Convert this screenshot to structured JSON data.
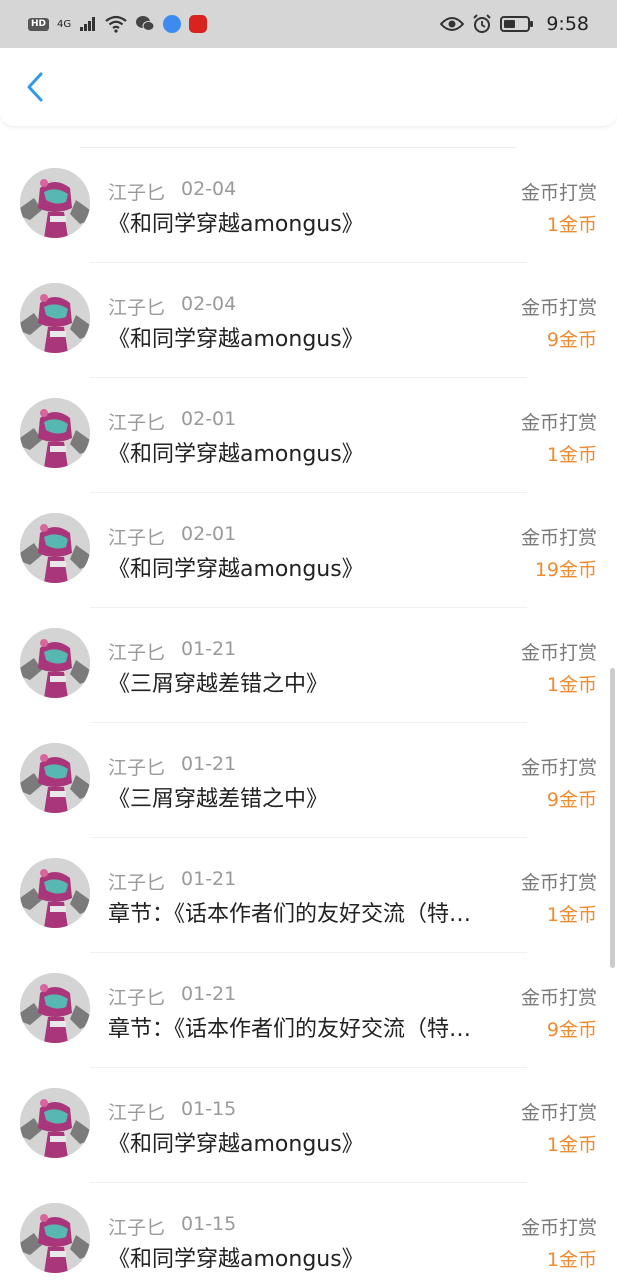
{
  "status_bar": {
    "network": "4G",
    "time": "9:58"
  },
  "nav": {
    "back_icon": "chevron-left-icon",
    "accent": "#2f9be8"
  },
  "colors": {
    "amount": "#f08b2f"
  },
  "records": [
    {
      "user": "江子匕",
      "date": "02-04",
      "title": "《和同学穿越amongus》",
      "type": "金币打赏",
      "amount": "1金币"
    },
    {
      "user": "江子匕",
      "date": "02-04",
      "title": "《和同学穿越amongus》",
      "type": "金币打赏",
      "amount": "9金币"
    },
    {
      "user": "江子匕",
      "date": "02-01",
      "title": "《和同学穿越amongus》",
      "type": "金币打赏",
      "amount": "1金币"
    },
    {
      "user": "江子匕",
      "date": "02-01",
      "title": "《和同学穿越amongus》",
      "type": "金币打赏",
      "amount": "19金币"
    },
    {
      "user": "江子匕",
      "date": "01-21",
      "title": "《三屑穿越差错之中》",
      "type": "金币打赏",
      "amount": "1金币"
    },
    {
      "user": "江子匕",
      "date": "01-21",
      "title": "《三屑穿越差错之中》",
      "type": "金币打赏",
      "amount": "9金币"
    },
    {
      "user": "江子匕",
      "date": "01-21",
      "title": "章节：《话本作者们的友好交流（特…",
      "type": "金币打赏",
      "amount": "1金币"
    },
    {
      "user": "江子匕",
      "date": "01-21",
      "title": "章节：《话本作者们的友好交流（特…",
      "type": "金币打赏",
      "amount": "9金币"
    },
    {
      "user": "江子匕",
      "date": "01-15",
      "title": "《和同学穿越amongus》",
      "type": "金币打赏",
      "amount": "1金币"
    },
    {
      "user": "江子匕",
      "date": "01-15",
      "title": "《和同学穿越amongus》",
      "type": "金币打赏",
      "amount": "1金币"
    }
  ]
}
